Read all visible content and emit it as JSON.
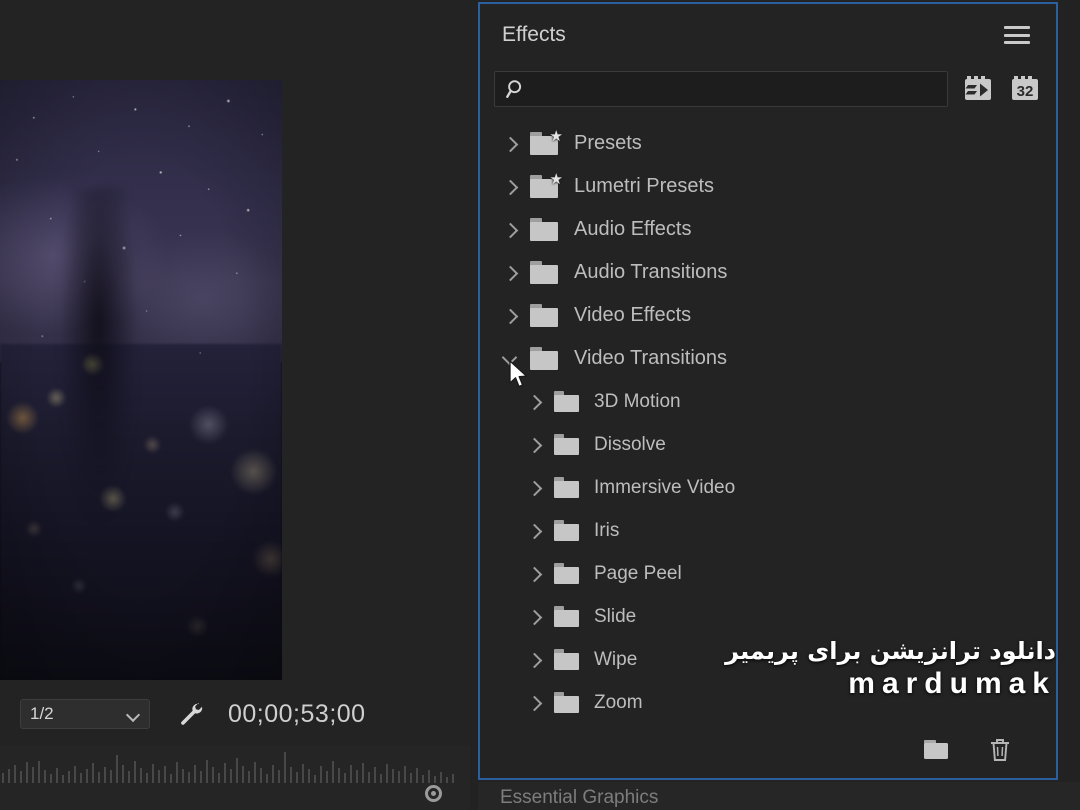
{
  "monitor": {
    "resolution": {
      "value": "1/2",
      "name": "playback-resolution"
    },
    "settings_icon": "wrench-icon",
    "timecode": "00;00;53;00",
    "marker_icon": "marker-circle-icon"
  },
  "effects": {
    "title": "Effects",
    "menu_icon": "hamburger-menu-icon",
    "search": {
      "placeholder": "",
      "value": "",
      "icon": "search-icon"
    },
    "filters": [
      {
        "name": "accelerated-effects-filter-icon",
        "label": "Accelerated Effects"
      },
      {
        "name": "32-bit-color-filter-icon",
        "label": "32"
      }
    ],
    "tree": [
      {
        "label": "Presets",
        "level": 1,
        "expanded": false,
        "icon": "preset-folder-icon"
      },
      {
        "label": "Lumetri Presets",
        "level": 1,
        "expanded": false,
        "icon": "preset-folder-icon"
      },
      {
        "label": "Audio Effects",
        "level": 1,
        "expanded": false,
        "icon": "folder-icon"
      },
      {
        "label": "Audio Transitions",
        "level": 1,
        "expanded": false,
        "icon": "folder-icon"
      },
      {
        "label": "Video Effects",
        "level": 1,
        "expanded": false,
        "icon": "folder-icon"
      },
      {
        "label": "Video Transitions",
        "level": 1,
        "expanded": true,
        "icon": "folder-icon"
      },
      {
        "label": "3D Motion",
        "level": 2,
        "expanded": false,
        "icon": "folder-icon"
      },
      {
        "label": "Dissolve",
        "level": 2,
        "expanded": false,
        "icon": "folder-icon"
      },
      {
        "label": "Immersive Video",
        "level": 2,
        "expanded": false,
        "icon": "folder-icon"
      },
      {
        "label": "Iris",
        "level": 2,
        "expanded": false,
        "icon": "folder-icon"
      },
      {
        "label": "Page Peel",
        "level": 2,
        "expanded": false,
        "icon": "folder-icon"
      },
      {
        "label": "Slide",
        "level": 2,
        "expanded": false,
        "icon": "folder-icon"
      },
      {
        "label": "Wipe",
        "level": 2,
        "expanded": false,
        "icon": "folder-icon"
      },
      {
        "label": "Zoom",
        "level": 2,
        "expanded": false,
        "icon": "folder-icon"
      }
    ],
    "footer": [
      {
        "name": "new-custom-bin-button",
        "icon": "folder-icon"
      },
      {
        "name": "delete-custom-item-button",
        "icon": "trash-icon"
      }
    ]
  },
  "bottom_tab": {
    "label": "Essential Graphics"
  },
  "watermark": {
    "persian": "دانلود ترانزیشن برای پریمیر",
    "brand": "mardumak"
  },
  "colors": {
    "panel_focus_border": "#2c5f9e",
    "panel_bg": "#232323",
    "app_bg": "#222222",
    "text": "#bdbdbd",
    "folder": "#c6c6c6"
  }
}
